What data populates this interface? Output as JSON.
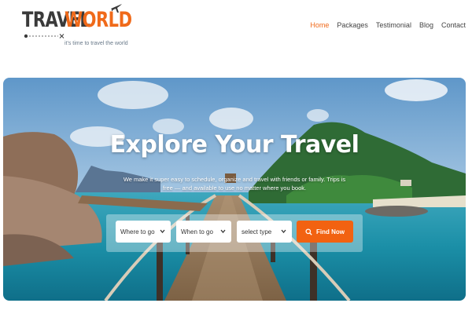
{
  "logo": {
    "word1": "TRAVEL",
    "word2": "WORLD",
    "tagline": "it's time to travel the world",
    "accent": "#f06a1a",
    "dark": "#3a3a3a",
    "icon": "airplane-icon"
  },
  "nav": {
    "items": [
      {
        "label": "Home",
        "active": true
      },
      {
        "label": "Packages",
        "active": false
      },
      {
        "label": "Testimonial",
        "active": false
      },
      {
        "label": "Blog",
        "active": false
      },
      {
        "label": "Contact",
        "active": false
      }
    ]
  },
  "hero": {
    "title": "Explore Your Travel",
    "subtitle": "We make it super easy to schedule, organize and travel with friends or family. Trips is free — and available to use no matter where you book."
  },
  "search": {
    "where_placeholder": "Where to go",
    "when_placeholder": "When to go",
    "type_placeholder": "select type",
    "button_label": "Find Now",
    "button_color": "#f26211"
  }
}
